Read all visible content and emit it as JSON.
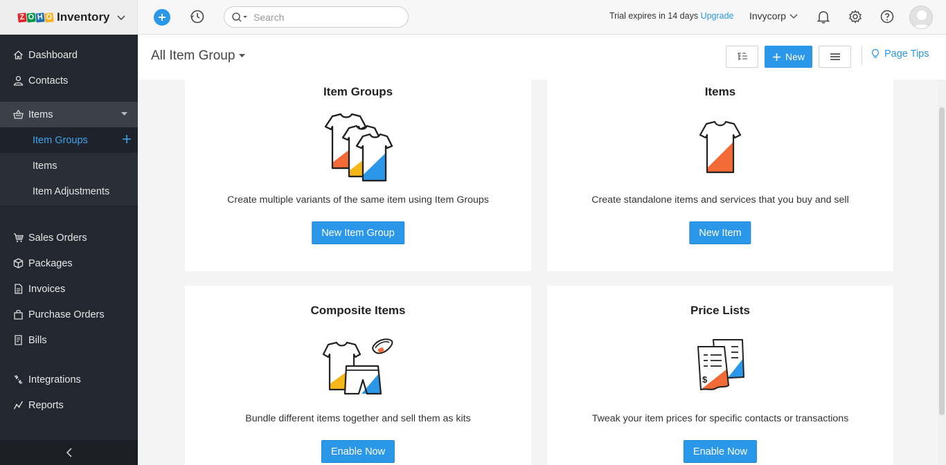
{
  "app": {
    "brand_name": "Inventory",
    "logo_letters": [
      "Z",
      "O",
      "H",
      "O"
    ],
    "logo_colors": [
      "#e42527",
      "#089949",
      "#226db4",
      "#f9b21d"
    ]
  },
  "topbar": {
    "search_placeholder": "Search",
    "trial_text": "Trial expires in 14 days",
    "upgrade_label": "Upgrade",
    "org_name": "Invycorp"
  },
  "sidebar": {
    "items": [
      {
        "label": "Dashboard",
        "icon": "home-icon"
      },
      {
        "label": "Contacts",
        "icon": "user-icon"
      },
      {
        "label": "Items",
        "icon": "basket-icon"
      },
      {
        "label": "Sales Orders",
        "icon": "cart-icon"
      },
      {
        "label": "Packages",
        "icon": "package-icon"
      },
      {
        "label": "Invoices",
        "icon": "invoice-icon"
      },
      {
        "label": "Purchase Orders",
        "icon": "bag-icon"
      },
      {
        "label": "Bills",
        "icon": "bill-icon"
      },
      {
        "label": "Integrations",
        "icon": "integrations-icon"
      },
      {
        "label": "Reports",
        "icon": "reports-icon"
      }
    ],
    "sub_items": [
      {
        "label": "Item Groups",
        "active": true
      },
      {
        "label": "Items"
      },
      {
        "label": "Item Adjustments"
      }
    ]
  },
  "header": {
    "title": "All Item Group",
    "new_label": "New",
    "page_tips_label": "Page Tips"
  },
  "cards": [
    {
      "title": "Item Groups",
      "description": "Create multiple variants of the same item using Item Groups",
      "button": "New Item Group"
    },
    {
      "title": "Items",
      "description": "Create standalone items and services that you buy and sell",
      "button": "New Item"
    },
    {
      "title": "Composite Items",
      "description": "Bundle different items together and sell them as kits",
      "button": "Enable Now"
    },
    {
      "title": "Price Lists",
      "description": "Tweak your item prices for specific contacts or transactions",
      "button": "Enable Now"
    }
  ],
  "colors": {
    "accent": "#2a97e8",
    "sidebar_bg": "#23272f",
    "orange": "#f26a35",
    "blue": "#2a97e8",
    "yellow": "#f5b617"
  }
}
